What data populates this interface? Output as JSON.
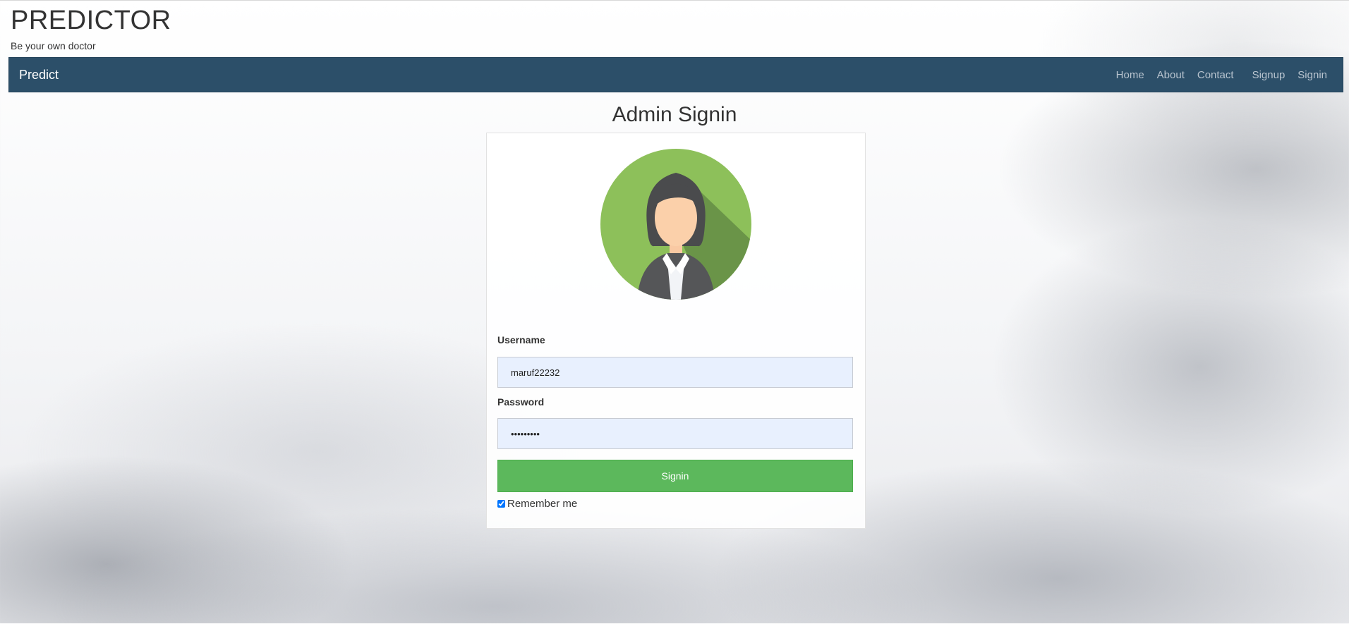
{
  "header": {
    "title": "PREDICTOR",
    "tagline": "Be your own doctor"
  },
  "navbar": {
    "brand": "Predict",
    "links": [
      "Home",
      "About",
      "Contact",
      "Signup",
      "Signin"
    ],
    "background_color": "#2c4f69"
  },
  "page": {
    "heading": "Admin Signin"
  },
  "form": {
    "avatar_icon": "female-user-avatar-icon",
    "username_label": "Username",
    "username_value": "maruf22232",
    "password_label": "Password",
    "password_value": "•••••••••",
    "signin_label": "Signin",
    "remember_label": "Remember me",
    "remember_checked": true,
    "button_color": "#5cb85c"
  }
}
